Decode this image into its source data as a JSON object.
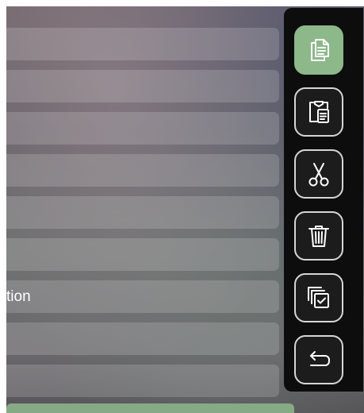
{
  "list": {
    "items": [
      {
        "label": ""
      },
      {
        "label": ""
      },
      {
        "label": ""
      },
      {
        "label": ""
      },
      {
        "label": ""
      },
      {
        "label": ""
      },
      {
        "label": "tion"
      },
      {
        "label": ""
      },
      {
        "label": ""
      }
    ]
  },
  "toolbar": {
    "buttons": [
      {
        "name": "copy",
        "icon": "copy-icon",
        "active": true
      },
      {
        "name": "paste",
        "icon": "paste-icon",
        "active": false
      },
      {
        "name": "cut",
        "icon": "scissors-icon",
        "active": false
      },
      {
        "name": "delete",
        "icon": "trash-icon",
        "active": false
      },
      {
        "name": "select-all",
        "icon": "select-all-icon",
        "active": false
      },
      {
        "name": "back",
        "icon": "back-arrow-icon",
        "active": false
      }
    ]
  },
  "colors": {
    "accent": "#8db88a",
    "panel": "#0d0d0d",
    "icon_stroke": "#ffffff"
  }
}
